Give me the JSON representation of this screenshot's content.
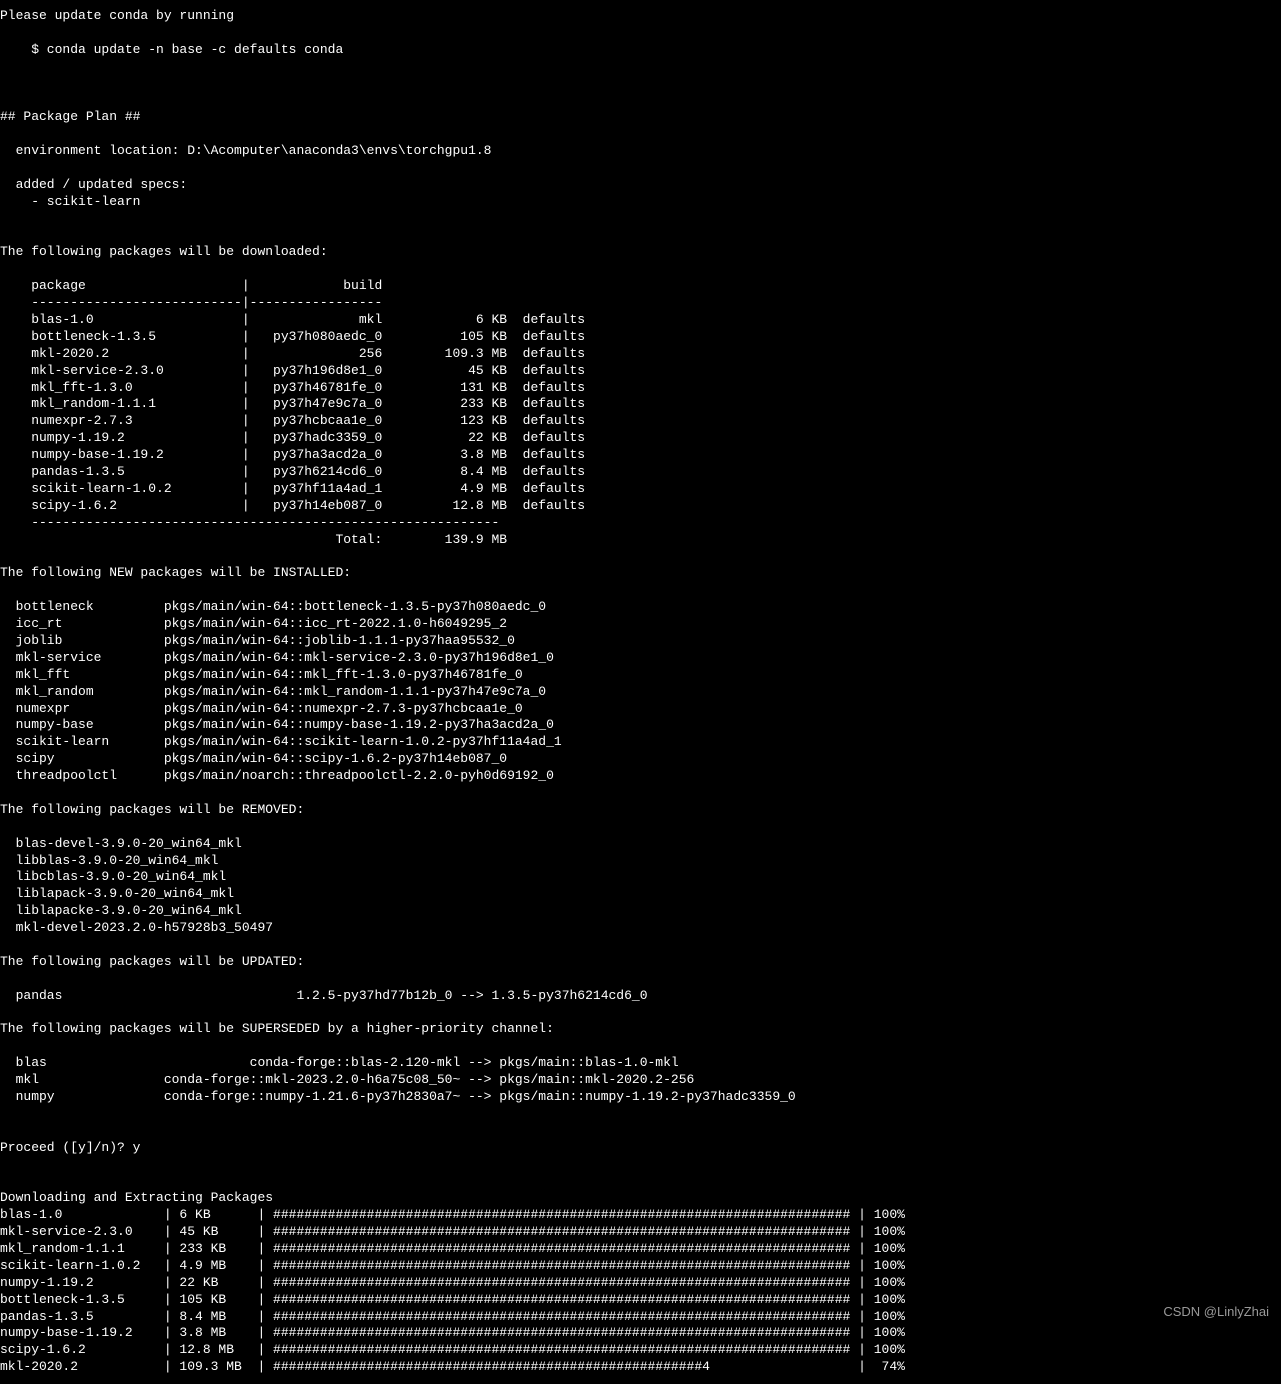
{
  "intro": {
    "line1": "Please update conda by running",
    "line2": "    $ conda update -n base -c defaults conda",
    "plan_header": "## Package Plan ##",
    "env_loc": "  environment location: D:\\Acomputer\\anaconda3\\envs\\torchgpu1.8",
    "added_specs_h": "  added / updated specs:",
    "added_specs_v": "    - scikit-learn"
  },
  "downloads_header": "The following packages will be downloaded:",
  "table_header_package": "package",
  "table_header_build": "build",
  "downloads": [
    {
      "pkg": "blas-1.0",
      "build": "mkl",
      "size": "6 KB",
      "channel": "defaults"
    },
    {
      "pkg": "bottleneck-1.3.5",
      "build": "py37h080aedc_0",
      "size": "105 KB",
      "channel": "defaults"
    },
    {
      "pkg": "mkl-2020.2",
      "build": "256",
      "size": "109.3 MB",
      "channel": "defaults"
    },
    {
      "pkg": "mkl-service-2.3.0",
      "build": "py37h196d8e1_0",
      "size": "45 KB",
      "channel": "defaults"
    },
    {
      "pkg": "mkl_fft-1.3.0",
      "build": "py37h46781fe_0",
      "size": "131 KB",
      "channel": "defaults"
    },
    {
      "pkg": "mkl_random-1.1.1",
      "build": "py37h47e9c7a_0",
      "size": "233 KB",
      "channel": "defaults"
    },
    {
      "pkg": "numexpr-2.7.3",
      "build": "py37hcbcaa1e_0",
      "size": "123 KB",
      "channel": "defaults"
    },
    {
      "pkg": "numpy-1.19.2",
      "build": "py37hadc3359_0",
      "size": "22 KB",
      "channel": "defaults"
    },
    {
      "pkg": "numpy-base-1.19.2",
      "build": "py37ha3acd2a_0",
      "size": "3.8 MB",
      "channel": "defaults"
    },
    {
      "pkg": "pandas-1.3.5",
      "build": "py37h6214cd6_0",
      "size": "8.4 MB",
      "channel": "defaults"
    },
    {
      "pkg": "scikit-learn-1.0.2",
      "build": "py37hf11a4ad_1",
      "size": "4.9 MB",
      "channel": "defaults"
    },
    {
      "pkg": "scipy-1.6.2",
      "build": "py37h14eb087_0",
      "size": "12.8 MB",
      "channel": "defaults"
    }
  ],
  "total_label": "Total:",
  "total_size": "139.9 MB",
  "installed_header": "The following NEW packages will be INSTALLED:",
  "installed": [
    {
      "name": "bottleneck",
      "spec": "pkgs/main/win-64::bottleneck-1.3.5-py37h080aedc_0"
    },
    {
      "name": "icc_rt",
      "spec": "pkgs/main/win-64::icc_rt-2022.1.0-h6049295_2"
    },
    {
      "name": "joblib",
      "spec": "pkgs/main/win-64::joblib-1.1.1-py37haa95532_0"
    },
    {
      "name": "mkl-service",
      "spec": "pkgs/main/win-64::mkl-service-2.3.0-py37h196d8e1_0"
    },
    {
      "name": "mkl_fft",
      "spec": "pkgs/main/win-64::mkl_fft-1.3.0-py37h46781fe_0"
    },
    {
      "name": "mkl_random",
      "spec": "pkgs/main/win-64::mkl_random-1.1.1-py37h47e9c7a_0"
    },
    {
      "name": "numexpr",
      "spec": "pkgs/main/win-64::numexpr-2.7.3-py37hcbcaa1e_0"
    },
    {
      "name": "numpy-base",
      "spec": "pkgs/main/win-64::numpy-base-1.19.2-py37ha3acd2a_0"
    },
    {
      "name": "scikit-learn",
      "spec": "pkgs/main/win-64::scikit-learn-1.0.2-py37hf11a4ad_1"
    },
    {
      "name": "scipy",
      "spec": "pkgs/main/win-64::scipy-1.6.2-py37h14eb087_0"
    },
    {
      "name": "threadpoolctl",
      "spec": "pkgs/main/noarch::threadpoolctl-2.2.0-pyh0d69192_0"
    }
  ],
  "removed_header": "The following packages will be REMOVED:",
  "removed": [
    "blas-devel-3.9.0-20_win64_mkl",
    "libblas-3.9.0-20_win64_mkl",
    "libcblas-3.9.0-20_win64_mkl",
    "liblapack-3.9.0-20_win64_mkl",
    "liblapacke-3.9.0-20_win64_mkl",
    "mkl-devel-2023.2.0-h57928b3_50497"
  ],
  "updated_header": "The following packages will be UPDATED:",
  "updated": [
    {
      "name": "pandas",
      "from": "1.2.5-py37hd77b12b_0",
      "to": "1.3.5-py37h6214cd6_0"
    }
  ],
  "superseded_header": "The following packages will be SUPERSEDED by a higher-priority channel:",
  "superseded": [
    {
      "name": "blas",
      "from": "conda-forge::blas-2.120-mkl",
      "to": "pkgs/main::blas-1.0-mkl"
    },
    {
      "name": "mkl",
      "from": "conda-forge::mkl-2023.2.0-h6a75c08_50~",
      "to": "pkgs/main::mkl-2020.2-256"
    },
    {
      "name": "numpy",
      "from": "conda-forge::numpy-1.21.6-py37h2830a7~",
      "to": "pkgs/main::numpy-1.19.2-py37hadc3359_0"
    }
  ],
  "proceed_prompt": "Proceed ([y]/n)? y",
  "extract_header": "Downloading and Extracting Packages",
  "progress": [
    {
      "pkg": "blas-1.0",
      "size": "6 KB",
      "pct": 100
    },
    {
      "pkg": "mkl-service-2.3.0",
      "size": "45 KB",
      "pct": 100
    },
    {
      "pkg": "mkl_random-1.1.1",
      "size": "233 KB",
      "pct": 100
    },
    {
      "pkg": "scikit-learn-1.0.2",
      "size": "4.9 MB",
      "pct": 100
    },
    {
      "pkg": "numpy-1.19.2",
      "size": "22 KB",
      "pct": 100
    },
    {
      "pkg": "bottleneck-1.3.5",
      "size": "105 KB",
      "pct": 100
    },
    {
      "pkg": "pandas-1.3.5",
      "size": "8.4 MB",
      "pct": 100
    },
    {
      "pkg": "numpy-base-1.19.2",
      "size": "3.8 MB",
      "pct": 100
    },
    {
      "pkg": "scipy-1.6.2",
      "size": "12.8 MB",
      "pct": 100
    },
    {
      "pkg": "mkl-2020.2",
      "size": "109.3 MB",
      "pct": 74
    }
  ],
  "watermark": "CSDN @LinlyZhai"
}
